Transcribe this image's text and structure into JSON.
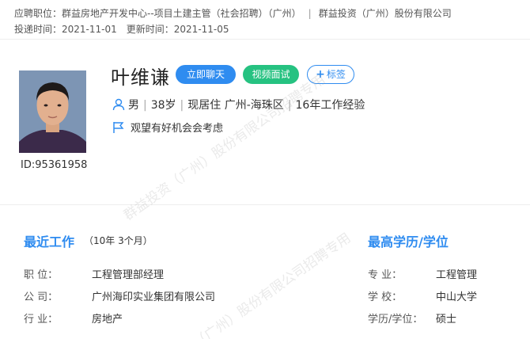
{
  "header": {
    "apply_label": "应聘职位：",
    "apply_position": "群益房地产开发中心--项目土建主管（社会招聘）（广州）",
    "separator": "|",
    "company": "群益投资（广州）股份有限公司",
    "delivered_label": "投递时间：",
    "delivered_date": "2021-11-01",
    "updated_label": "更新时间：",
    "updated_date": "2021-11-05"
  },
  "profile": {
    "name": "叶维谦",
    "id_text": "ID:95361958",
    "gender": "男",
    "age": "38岁",
    "residence": "现居住 广州-海珠区",
    "experience": "16年工作经验",
    "job_status": "观望有好机会会考虑",
    "info_sep": "|"
  },
  "actions": {
    "chat_label": "立即聊天",
    "video_label": "视频面试",
    "tag_label": "标签"
  },
  "recent_work": {
    "title": "最近工作",
    "duration": "（10年 3个月）",
    "rows": [
      {
        "label": "职    位：",
        "value": "工程管理部经理"
      },
      {
        "label": "公    司：",
        "value": "广州海印实业集团有限公司"
      },
      {
        "label": "行    业：",
        "value": "房地产"
      }
    ]
  },
  "education": {
    "title": "最高学历/学位",
    "rows": [
      {
        "label": "专    业：",
        "value": "工程管理"
      },
      {
        "label": "学    校：",
        "value": "中山大学"
      },
      {
        "label": "学历/学位：",
        "value": "硕士"
      }
    ]
  },
  "watermarks": [
    "群益投资（广州）股份有限公司招聘专用",
    "（广州）股份有限公司招聘专用"
  ],
  "colors": {
    "accent": "#2f8cf0",
    "video": "#26c281"
  }
}
